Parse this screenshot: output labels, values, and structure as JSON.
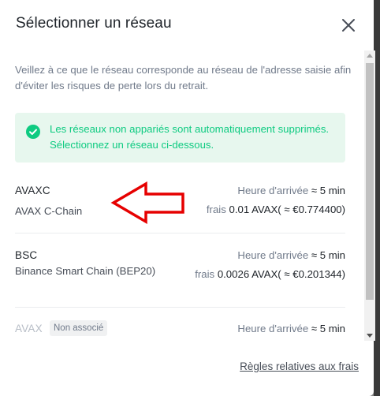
{
  "modal": {
    "title": "Sélectionner un réseau",
    "close_icon": "close-icon",
    "note": "Veillez à ce que le réseau corresponde au réseau de l'adresse saisie afin d'éviter les risques de perte lors du retrait.",
    "alert": {
      "icon": "check-circle-icon",
      "text": "Les réseaux non appariés sont automatiquement supprimés. Sélectionnez un réseau ci-dessous.",
      "color": "#0ecb81"
    },
    "networks": [
      {
        "code": "AVAXC",
        "name": "AVAX C-Chain",
        "arrival_label": "Heure d'arrivée",
        "arrival_value": "≈ 5 min",
        "fee_label": "frais",
        "fee_value": "0.01 AVAX( ≈ €0.774400)"
      },
      {
        "code": "BSC",
        "name": "Binance Smart Chain (BEP20)",
        "arrival_label": "Heure d'arrivée",
        "arrival_value": "≈ 5 min",
        "fee_label": "frais",
        "fee_value": "0.0026 AVAX( ≈ €0.201344)"
      },
      {
        "code": "AVAX",
        "badge": "Non associé",
        "arrival_label": "Heure d'arrivée",
        "arrival_value": "≈ 5 min"
      }
    ],
    "fees_link": "Règles relatives aux frais"
  },
  "annotation": {
    "icon": "red-arrow-left-icon",
    "color": "#e60000"
  }
}
